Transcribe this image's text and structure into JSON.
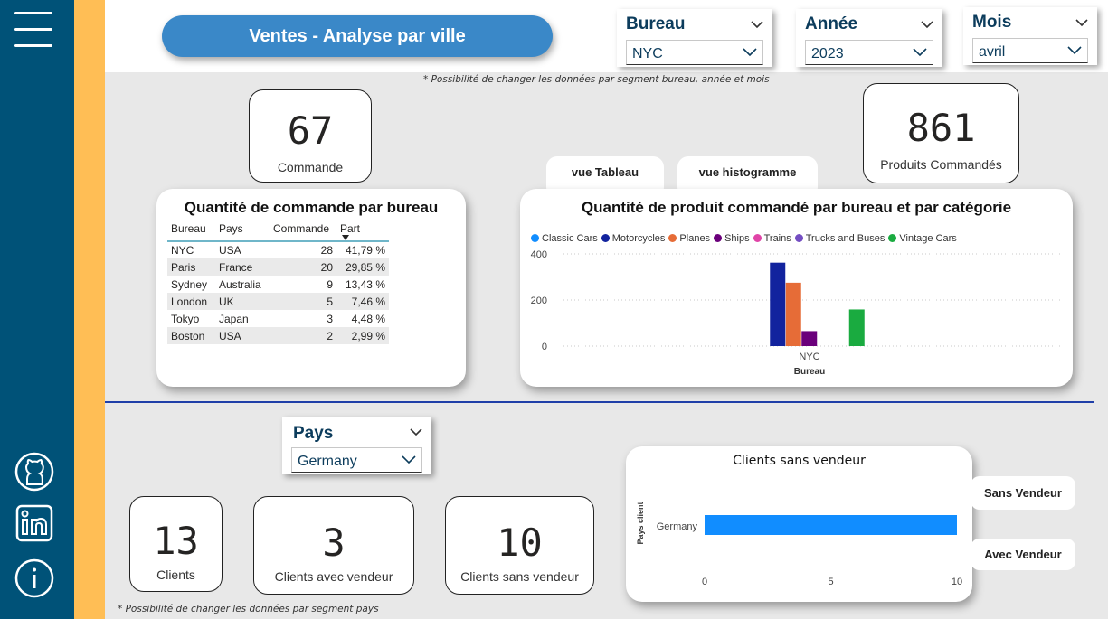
{
  "nav": {
    "icons": [
      "hamburger-menu-icon",
      "github-icon",
      "linkedin-icon",
      "info-icon"
    ]
  },
  "header": {
    "title": "Ventes - Analyse par ville",
    "note": "* Possibilité de changer les données par segment bureau, année et mois"
  },
  "slicers": {
    "bureau": {
      "label": "Bureau",
      "value": "NYC"
    },
    "annee": {
      "label": "Année",
      "value": "2023"
    },
    "mois": {
      "label": "Mois",
      "value": "avril"
    },
    "pays": {
      "label": "Pays",
      "value": "Germany"
    }
  },
  "kpis": {
    "commande": {
      "value": "67",
      "label": "Commande"
    },
    "produits": {
      "value": "861",
      "label": "Produits Commandés"
    },
    "clients": {
      "value": "13",
      "label": "Clients"
    },
    "clients_avec": {
      "value": "3",
      "label": "Clients avec vendeur"
    },
    "clients_sans": {
      "value": "10",
      "label": "Clients sans vendeur"
    }
  },
  "table_panel": {
    "title": "Quantité de commande par bureau",
    "columns": [
      "Bureau",
      "Pays",
      "Commande",
      "Part"
    ],
    "rows": [
      [
        "NYC",
        "USA",
        "28",
        "41,79 %"
      ],
      [
        "Paris",
        "France",
        "20",
        "29,85 %"
      ],
      [
        "Sydney",
        "Australia",
        "9",
        "13,43 %"
      ],
      [
        "London",
        "UK",
        "5",
        "7,46 %"
      ],
      [
        "Tokyo",
        "Japan",
        "3",
        "4,48 %"
      ],
      [
        "Boston",
        "USA",
        "2",
        "2,99 %"
      ]
    ]
  },
  "view_buttons": {
    "table": "vue Tableau",
    "histogram": "vue histogramme"
  },
  "lower": {
    "note": "* Possibilité de changer les données par segment pays",
    "sans_vendeur_btn": "Sans Vendeur",
    "avec_vendeur_btn": "Avec Vendeur"
  },
  "chart_data": [
    {
      "type": "bar",
      "title": "Quantité de produit commandé par bureau et par catégorie",
      "xlabel": "Bureau",
      "ylabel": "",
      "categories": [
        "NYC"
      ],
      "series": [
        {
          "name": "Classic Cars",
          "color": "#118dff",
          "values": [
            0
          ]
        },
        {
          "name": "Motorcycles",
          "color": "#12239e",
          "values": [
            362
          ]
        },
        {
          "name": "Planes",
          "color": "#e66c37",
          "values": [
            275
          ]
        },
        {
          "name": "Ships",
          "color": "#6b007b",
          "values": [
            65
          ]
        },
        {
          "name": "Trains",
          "color": "#e044a7",
          "values": [
            0
          ]
        },
        {
          "name": "Trucks and Buses",
          "color": "#744ec2",
          "values": [
            0
          ]
        },
        {
          "name": "Vintage Cars",
          "color": "#1aab40",
          "values": [
            159
          ]
        }
      ],
      "yticks": [
        "0",
        "200",
        "400"
      ],
      "ylim": [
        0,
        400
      ],
      "grid": true,
      "legend": "top-left"
    },
    {
      "type": "bar",
      "orientation": "horizontal",
      "title": "Clients sans vendeur",
      "ylabel": "Pays client",
      "xlabel": "",
      "categories": [
        "Germany"
      ],
      "values": [
        10
      ],
      "color": "#118dff",
      "xticks": [
        "0",
        "5",
        "10"
      ],
      "xlim": [
        0,
        10
      ]
    }
  ]
}
